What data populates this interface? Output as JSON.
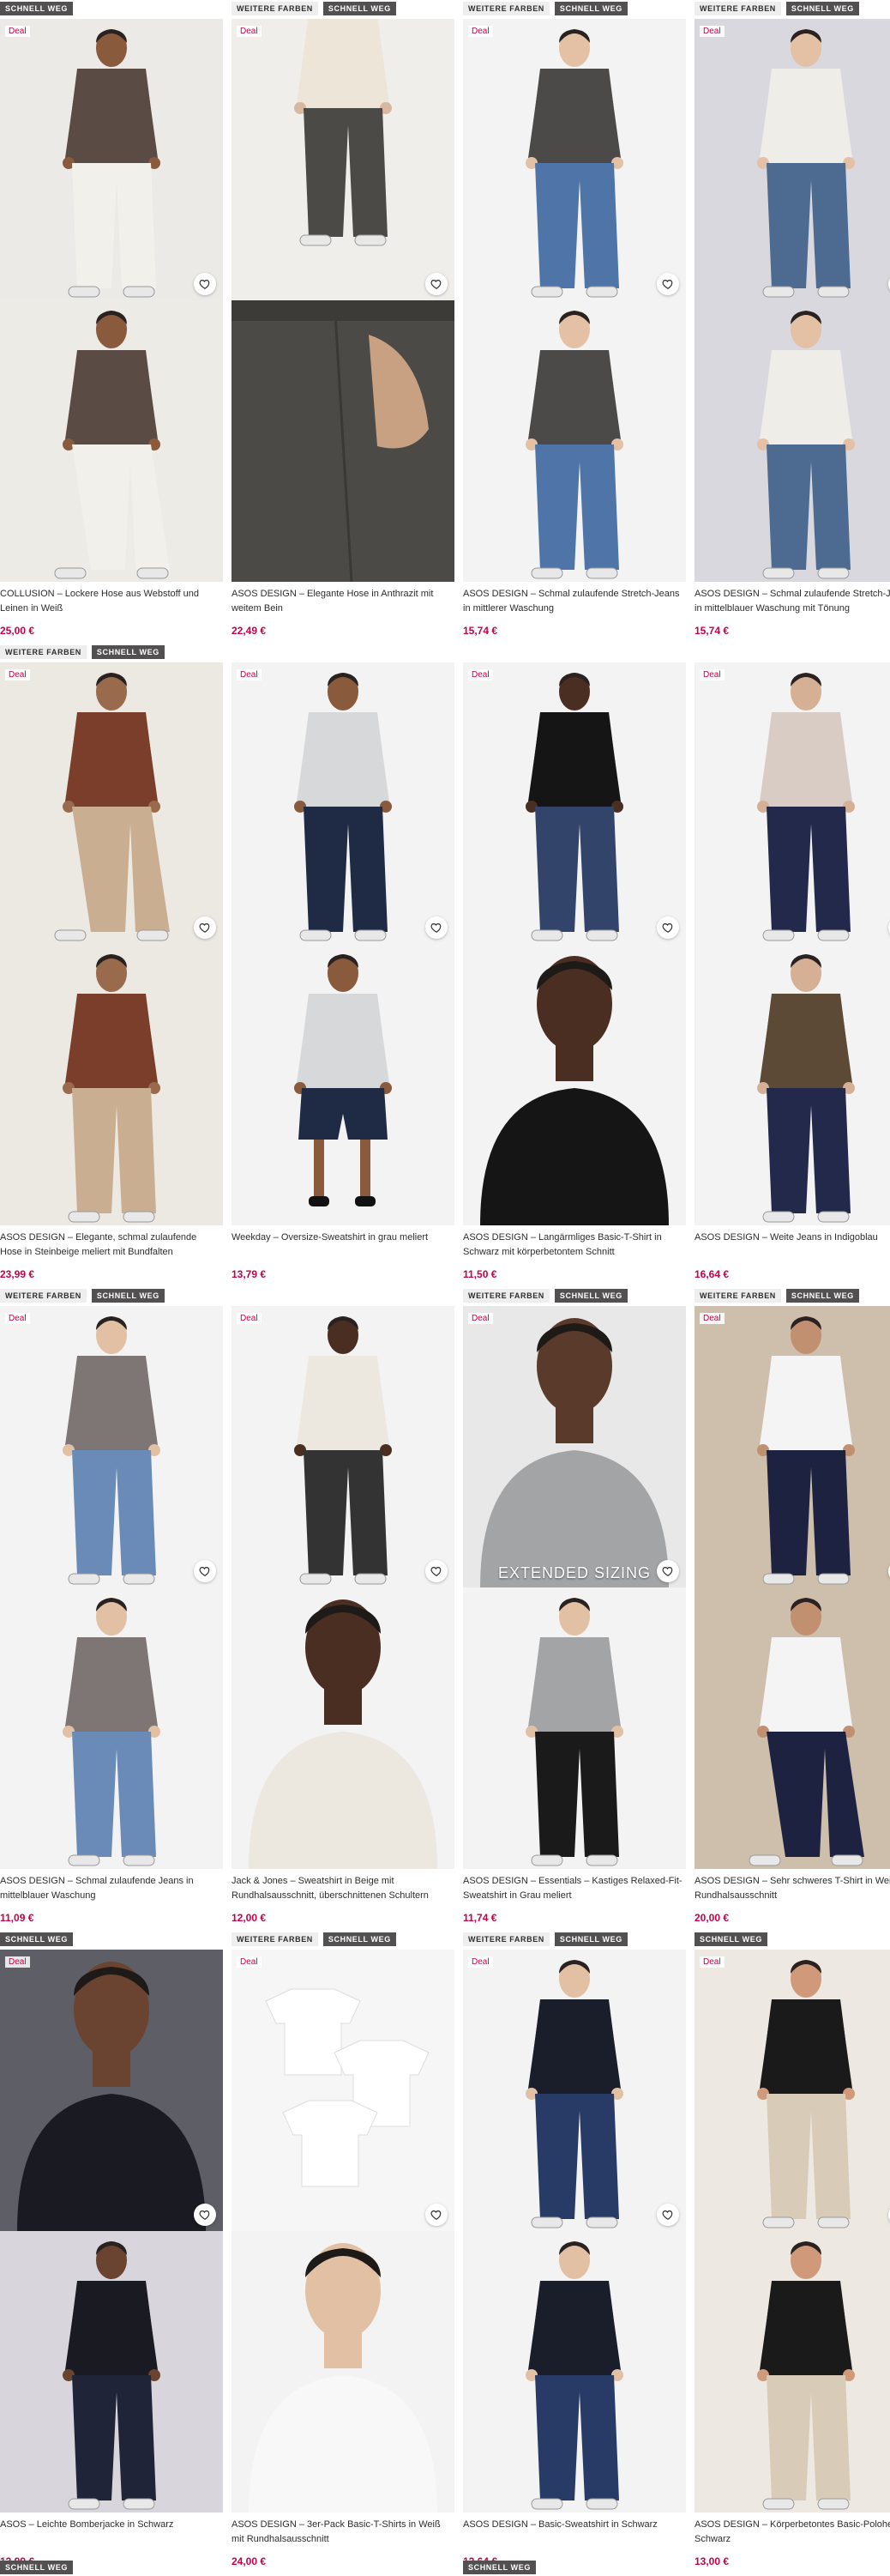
{
  "labels": {
    "more_colors": "WEITERE FARBEN",
    "selling_fast": "SCHNELL WEG",
    "deal": "Deal",
    "extended_sizing": "EXTENDED SIZING"
  },
  "colors": {
    "price": "#c4004c",
    "tag_dark": "#525050",
    "tag_light": "#eeeeee"
  },
  "products": [
    {
      "title": "COLLUSION – Lockere Hose aus Webstoff und Leinen in Weiß",
      "price": "25,00 €",
      "tags": [
        "selling_fast"
      ],
      "deal": true,
      "img1": {
        "bg": "#eceae6",
        "top": "#5a4c44",
        "bottom": "#f2f0ea",
        "skin": "#8a5a3c",
        "pose": "stand"
      },
      "img2": {
        "bg": "#ecebe6",
        "top": "#5a4c44",
        "bottom": "#f2f0ea",
        "skin": "#8a5a3c",
        "pose": "walk"
      }
    },
    {
      "title": "ASOS DESIGN – Elegante Hose in Anthrazit mit weitem Bein",
      "price": "22,49 €",
      "tags": [
        "more_colors",
        "selling_fast"
      ],
      "deal": true,
      "img1": {
        "bg": "#efeeeb",
        "top": "#ece5d8",
        "bottom": "#4b4a46",
        "skin": "#d8b8a0",
        "pose": "crop"
      },
      "img2": {
        "bg": "#4b4a46",
        "top": "#4b4a46",
        "bottom": "#4b4a46",
        "skin": "#c8a082",
        "pose": "detail"
      }
    },
    {
      "title": "ASOS DESIGN – Schmal zulaufende Stretch-Jeans in mittlerer Waschung",
      "price": "15,74 €",
      "tags": [
        "more_colors",
        "selling_fast"
      ],
      "deal": true,
      "img1": {
        "bg": "#f3f3f3",
        "top": "#4b4a48",
        "bottom": "#4f74a8",
        "skin": "#e4c0a4",
        "pose": "stand"
      },
      "img2": {
        "bg": "#f3f3f3",
        "top": "#4b4a48",
        "bottom": "#4f74a8",
        "skin": "#e4c0a4",
        "pose": "back"
      }
    },
    {
      "title": "ASOS DESIGN – Schmal zulaufende Stretch-Jeans in mittelblauer Waschung mit Tönung",
      "price": "15,74 €",
      "tags": [
        "more_colors",
        "selling_fast"
      ],
      "deal": true,
      "img1": {
        "bg": "#d9d8de",
        "top": "#efede8",
        "bottom": "#4d6a90",
        "skin": "#e4c0a4",
        "pose": "stand"
      },
      "img2": {
        "bg": "#d9d8de",
        "top": "#efede8",
        "bottom": "#4d6a90",
        "skin": "#e4c0a4",
        "pose": "back"
      }
    },
    {
      "title": "ASOS DESIGN – Elegante, schmal zulaufende Hose in Steinbeige meliert mit Bundfalten",
      "price": "23,99 €",
      "tags": [
        "more_colors",
        "selling_fast"
      ],
      "deal": true,
      "img1": {
        "bg": "#ece8e2",
        "top": "#7a3e2a",
        "bottom": "#c9ae92",
        "skin": "#9a6a4c",
        "pose": "walk"
      },
      "img2": {
        "bg": "#ece8e2",
        "top": "#7a3e2a",
        "bottom": "#c9ae92",
        "skin": "#9a6a4c",
        "pose": "stand"
      }
    },
    {
      "title": "Weekday – Oversize-Sweatshirt in grau meliert",
      "price": "13,79 €",
      "tags": [],
      "deal": true,
      "img1": {
        "bg": "#f3f3f3",
        "top": "#d6d8da",
        "bottom": "#1f2a44",
        "skin": "#8a5a3c",
        "pose": "stand"
      },
      "img2": {
        "bg": "#f3f3f3",
        "top": "#d6d8da",
        "bottom": "#1f2a44",
        "skin": "#8a5a3c",
        "pose": "shorts"
      }
    },
    {
      "title": "ASOS DESIGN – Langärmliges Basic-T-Shirt in Schwarz mit körperbetontem Schnitt",
      "price": "11,50 €",
      "tags": [],
      "deal": true,
      "img1": {
        "bg": "#f3f3f3",
        "top": "#151515",
        "bottom": "#33446a",
        "skin": "#4a2e22",
        "pose": "stand"
      },
      "img2": {
        "bg": "#f3f3f3",
        "top": "#151515",
        "bottom": "#151515",
        "skin": "#4a2e22",
        "pose": "close"
      }
    },
    {
      "title": "ASOS DESIGN – Weite Jeans in Indigoblau",
      "price": "16,64 €",
      "tags": [],
      "deal": true,
      "img1": {
        "bg": "#f3f3f3",
        "top": "#d8ccc4",
        "bottom": "#22294a",
        "skin": "#d6b094",
        "pose": "stand"
      },
      "img2": {
        "bg": "#f3f3f3",
        "top": "#5c4a36",
        "bottom": "#22294a",
        "skin": "#d6b094",
        "pose": "stand"
      }
    },
    {
      "title": "ASOS DESIGN – Schmal zulaufende Jeans in mittelblauer Waschung",
      "price": "11,09 €",
      "tags": [
        "more_colors",
        "selling_fast"
      ],
      "deal": true,
      "img1": {
        "bg": "#f3f3f3",
        "top": "#7d7674",
        "bottom": "#6a8ab8",
        "skin": "#e2c0a4",
        "pose": "stand"
      },
      "img2": {
        "bg": "#f3f3f3",
        "top": "#7d7674",
        "bottom": "#6a8ab8",
        "skin": "#e2c0a4",
        "pose": "back"
      }
    },
    {
      "title": "Jack & Jones – Sweatshirt in Beige mit Rundhalsausschnitt, überschnittenen Schultern und...",
      "price": "12,00 €",
      "tags": [],
      "deal": true,
      "img1": {
        "bg": "#f3f3f3",
        "top": "#ece8e0",
        "bottom": "#333333",
        "skin": "#4a2e22",
        "pose": "back"
      },
      "img2": {
        "bg": "#f3f3f3",
        "top": "#ece8e0",
        "bottom": "#ece8e0",
        "skin": "#4a2e22",
        "pose": "close"
      }
    },
    {
      "title": "ASOS DESIGN – Essentials – Kastiges Relaxed-Fit-Sweatshirt in Grau meliert",
      "price": "11,74 €",
      "tags": [
        "more_colors",
        "selling_fast"
      ],
      "deal": true,
      "extended": true,
      "img1": {
        "bg": "#e8e8e8",
        "top": "#a2a4a6",
        "bottom": "#a2a4a6",
        "skin": "#5a3a2a",
        "pose": "close"
      },
      "img2": {
        "bg": "#f3f3f3",
        "top": "#a2a4a6",
        "bottom": "#1a1a1a",
        "skin": "#e2c0a4",
        "pose": "stand"
      }
    },
    {
      "title": "ASOS DESIGN – Sehr schweres T-Shirt in Weiß mit Rundhalsausschnitt",
      "price": "20,00 €",
      "tags": [
        "more_colors",
        "selling_fast"
      ],
      "deal": true,
      "img1": {
        "bg": "#cdbfab",
        "top": "#f4f4f4",
        "bottom": "#1c2240",
        "skin": "#c09070",
        "pose": "stand"
      },
      "img2": {
        "bg": "#cdbfab",
        "top": "#f4f4f4",
        "bottom": "#1c2240",
        "skin": "#c09070",
        "pose": "walk"
      }
    },
    {
      "title": "ASOS – Leichte Bomberjacke in Schwarz",
      "price": "13,99 €",
      "tags": [
        "selling_fast"
      ],
      "deal": true,
      "img1": {
        "bg": "#5e5e66",
        "top": "#1a1a22",
        "bottom": "#1a1a22",
        "skin": "#6a4430",
        "pose": "close"
      },
      "img2": {
        "bg": "#d8d6dc",
        "top": "#1a1a22",
        "bottom": "#1f2438",
        "skin": "#6a4430",
        "pose": "stand"
      }
    },
    {
      "title": "ASOS DESIGN – 3er-Pack Basic-T-Shirts in Weiß mit Rundhalsausschnitt",
      "price": "24,00 €",
      "tags": [
        "more_colors",
        "selling_fast"
      ],
      "deal": true,
      "img1": {
        "bg": "#f6f6f6",
        "top": "#ffffff",
        "bottom": "#ffffff",
        "skin": "#ffffff",
        "pose": "flat"
      },
      "img2": {
        "bg": "#f3f3f3",
        "top": "#f8f8f8",
        "bottom": "#3d4e6e",
        "skin": "#e2c0a4",
        "pose": "close"
      }
    },
    {
      "title": "ASOS DESIGN – Basic-Sweatshirt in Schwarz",
      "price": "12,64 €",
      "tags": [
        "more_colors",
        "selling_fast"
      ],
      "deal": true,
      "img1": {
        "bg": "#f3f3f3",
        "top": "#1a1e2a",
        "bottom": "#283a66",
        "skin": "#e2c0a4",
        "pose": "stand"
      },
      "img2": {
        "bg": "#f3f3f3",
        "top": "#1a1e2a",
        "bottom": "#283a66",
        "skin": "#e2c0a4",
        "pose": "stand"
      }
    },
    {
      "title": "ASOS DESIGN – Körperbetontes Basic-Polohemd in Schwarz",
      "price": "13,00 €",
      "tags": [
        "selling_fast"
      ],
      "deal": true,
      "img1": {
        "bg": "#ede8e2",
        "top": "#1a1a1a",
        "bottom": "#d8ccb8",
        "skin": "#d09a7a",
        "pose": "stand"
      },
      "img2": {
        "bg": "#ede8e2",
        "top": "#1a1a1a",
        "bottom": "#d8ccb8",
        "skin": "#d09a7a",
        "pose": "stand"
      }
    }
  ],
  "trailing_tags": [
    [
      "selling_fast"
    ],
    [],
    [
      "selling_fast"
    ],
    []
  ]
}
